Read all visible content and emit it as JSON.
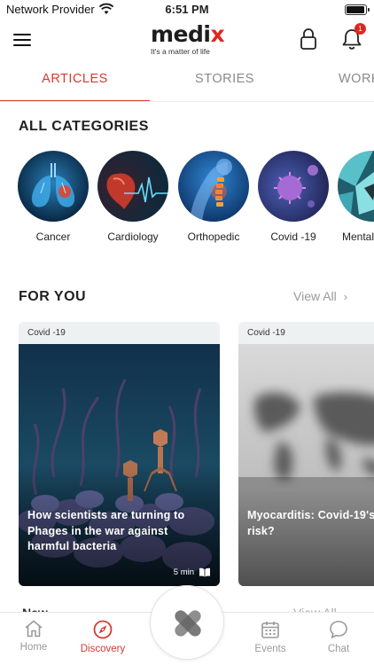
{
  "status_bar": {
    "carrier": "Network Provider",
    "time": "6:51 PM"
  },
  "header": {
    "logo_main": "medi",
    "logo_x": "x",
    "tagline": "It's a matter of life",
    "notification_count": "1"
  },
  "tabs": [
    {
      "label": "ARTICLES",
      "active": true
    },
    {
      "label": "STORIES",
      "active": false
    },
    {
      "label": "WORK",
      "active": false
    }
  ],
  "categories": {
    "title": "ALL CATEGORIES",
    "items": [
      {
        "label": "Cancer",
        "icon": "lungs-image"
      },
      {
        "label": "Cardiology",
        "icon": "heart-ecg-image"
      },
      {
        "label": "Orthopedic",
        "icon": "spine-image"
      },
      {
        "label": "Covid -19",
        "icon": "virus-image"
      },
      {
        "label": "Mental",
        "icon": "brain-image"
      }
    ]
  },
  "for_you": {
    "title": "FOR YOU",
    "view_all": "View All",
    "cards": [
      {
        "tag": "Covid -19",
        "title": "How scientists are turning to Phages in the war against harmful bacteria",
        "read_time": "5 min",
        "image": "phage-bacteria-image"
      },
      {
        "tag": "Covid -19",
        "title": "Myocarditis: Covid-19's risk?",
        "image": "world-map-image"
      }
    ]
  },
  "next_section": {
    "title": "New",
    "view_all": "View All"
  },
  "bottom_nav": {
    "items": [
      {
        "label": "Home",
        "icon": "home-icon",
        "active": false
      },
      {
        "label": "Discovery",
        "icon": "compass-icon",
        "active": true
      },
      {
        "label": "Events",
        "icon": "calendar-icon",
        "active": false
      },
      {
        "label": "Chat",
        "icon": "chat-icon",
        "active": false
      }
    ]
  },
  "colors": {
    "accent": "#d63a2f",
    "logo_x": "#e0271f",
    "muted": "#9a9a9a"
  }
}
